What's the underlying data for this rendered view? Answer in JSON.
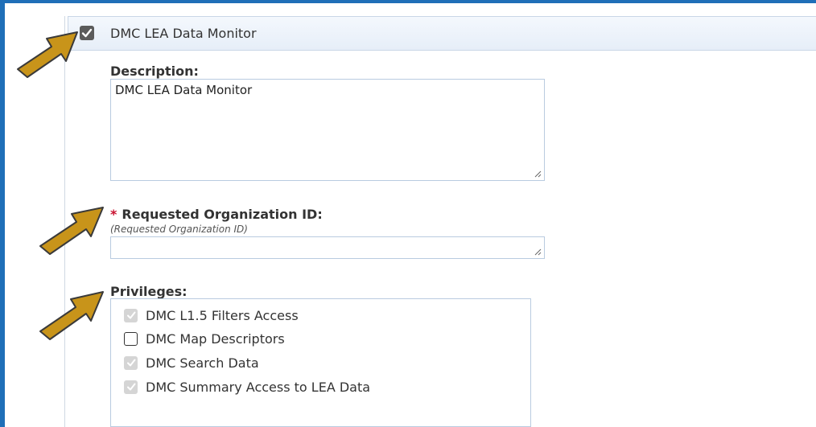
{
  "section": {
    "checkbox_checked": true,
    "title": "DMC LEA Data Monitor"
  },
  "description": {
    "label": "Description:",
    "value": "DMC LEA Data Monitor"
  },
  "org_id": {
    "required_mark": "*",
    "label": "Requested Organization ID:",
    "hint": "(Requested Organization ID)",
    "value": ""
  },
  "privileges": {
    "label": "Privileges:",
    "items": [
      {
        "label": "DMC L1.5 Filters Access",
        "checked": true,
        "disabled": true
      },
      {
        "label": "DMC Map Descriptors",
        "checked": false,
        "disabled": false
      },
      {
        "label": "DMC Search Data",
        "checked": true,
        "disabled": true
      },
      {
        "label": "DMC Summary Access to LEA Data",
        "checked": true,
        "disabled": true
      }
    ]
  },
  "colors": {
    "frame": "#1f6fb8",
    "arrow": "#c8941a",
    "required": "#c8102e"
  }
}
